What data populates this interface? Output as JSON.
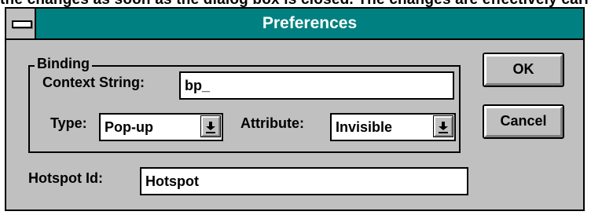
{
  "background_text": "the changes as soon as the dialog box is closed. The changes are effectively carried out in the",
  "dialog": {
    "title": "Preferences",
    "binding_group_label": "Binding",
    "context_string_label": "Context String:",
    "context_string_value": "bp_",
    "type_label": "Type:",
    "type_value": "Pop-up",
    "attribute_label": "Attribute:",
    "attribute_value": "Invisible",
    "hotspot_id_label": "Hotspot Id:",
    "hotspot_id_value": "Hotspot",
    "ok_label": "OK",
    "cancel_label": "Cancel"
  },
  "colors": {
    "titlebar": "#008080",
    "face": "#c0c0c0"
  },
  "icons": [
    "system-menu-icon",
    "dropdown-arrow-icon"
  ]
}
